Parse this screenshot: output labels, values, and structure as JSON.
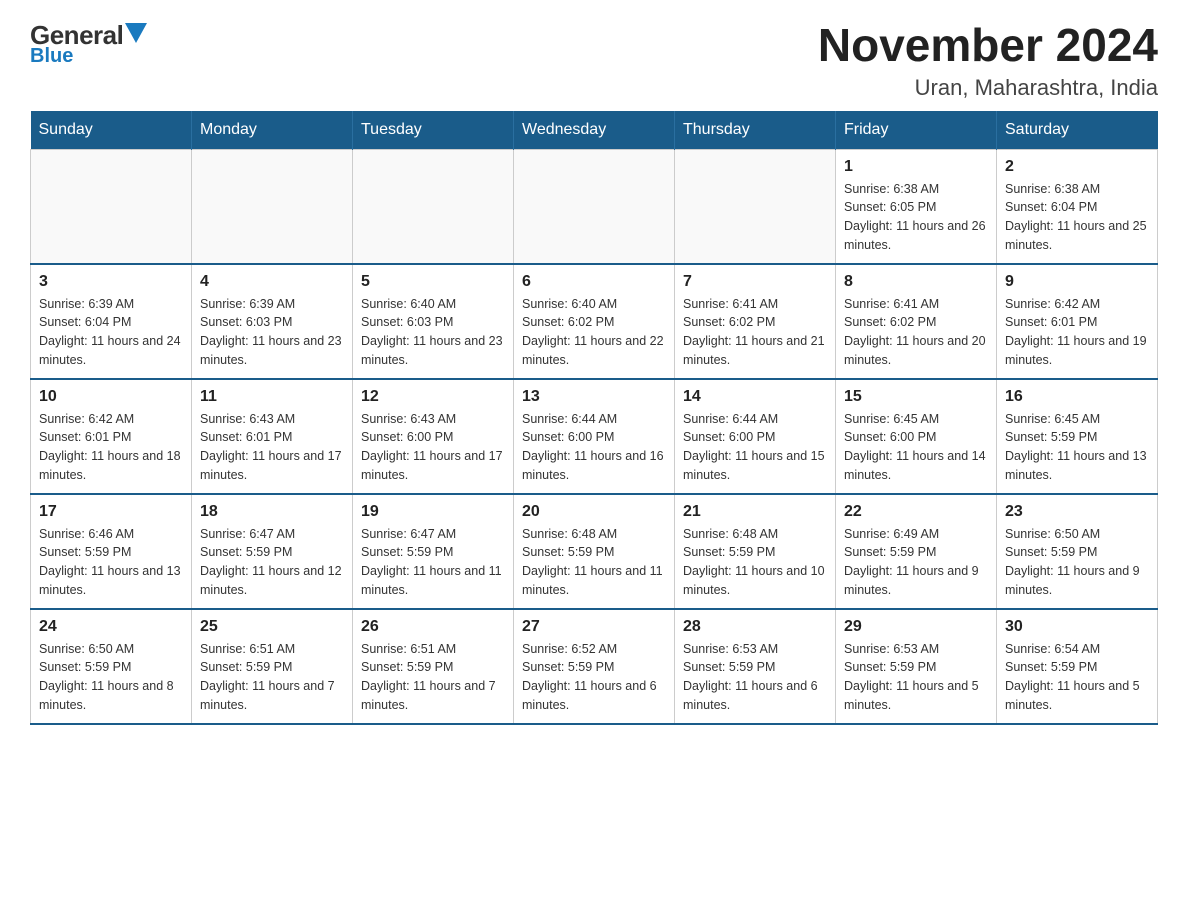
{
  "header": {
    "logo_general": "General",
    "logo_blue": "Blue",
    "month_title": "November 2024",
    "location": "Uran, Maharashtra, India"
  },
  "weekdays": [
    "Sunday",
    "Monday",
    "Tuesday",
    "Wednesday",
    "Thursday",
    "Friday",
    "Saturday"
  ],
  "weeks": [
    [
      {
        "day": "",
        "sunrise": "",
        "sunset": "",
        "daylight": ""
      },
      {
        "day": "",
        "sunrise": "",
        "sunset": "",
        "daylight": ""
      },
      {
        "day": "",
        "sunrise": "",
        "sunset": "",
        "daylight": ""
      },
      {
        "day": "",
        "sunrise": "",
        "sunset": "",
        "daylight": ""
      },
      {
        "day": "",
        "sunrise": "",
        "sunset": "",
        "daylight": ""
      },
      {
        "day": "1",
        "sunrise": "Sunrise: 6:38 AM",
        "sunset": "Sunset: 6:05 PM",
        "daylight": "Daylight: 11 hours and 26 minutes."
      },
      {
        "day": "2",
        "sunrise": "Sunrise: 6:38 AM",
        "sunset": "Sunset: 6:04 PM",
        "daylight": "Daylight: 11 hours and 25 minutes."
      }
    ],
    [
      {
        "day": "3",
        "sunrise": "Sunrise: 6:39 AM",
        "sunset": "Sunset: 6:04 PM",
        "daylight": "Daylight: 11 hours and 24 minutes."
      },
      {
        "day": "4",
        "sunrise": "Sunrise: 6:39 AM",
        "sunset": "Sunset: 6:03 PM",
        "daylight": "Daylight: 11 hours and 23 minutes."
      },
      {
        "day": "5",
        "sunrise": "Sunrise: 6:40 AM",
        "sunset": "Sunset: 6:03 PM",
        "daylight": "Daylight: 11 hours and 23 minutes."
      },
      {
        "day": "6",
        "sunrise": "Sunrise: 6:40 AM",
        "sunset": "Sunset: 6:02 PM",
        "daylight": "Daylight: 11 hours and 22 minutes."
      },
      {
        "day": "7",
        "sunrise": "Sunrise: 6:41 AM",
        "sunset": "Sunset: 6:02 PM",
        "daylight": "Daylight: 11 hours and 21 minutes."
      },
      {
        "day": "8",
        "sunrise": "Sunrise: 6:41 AM",
        "sunset": "Sunset: 6:02 PM",
        "daylight": "Daylight: 11 hours and 20 minutes."
      },
      {
        "day": "9",
        "sunrise": "Sunrise: 6:42 AM",
        "sunset": "Sunset: 6:01 PM",
        "daylight": "Daylight: 11 hours and 19 minutes."
      }
    ],
    [
      {
        "day": "10",
        "sunrise": "Sunrise: 6:42 AM",
        "sunset": "Sunset: 6:01 PM",
        "daylight": "Daylight: 11 hours and 18 minutes."
      },
      {
        "day": "11",
        "sunrise": "Sunrise: 6:43 AM",
        "sunset": "Sunset: 6:01 PM",
        "daylight": "Daylight: 11 hours and 17 minutes."
      },
      {
        "day": "12",
        "sunrise": "Sunrise: 6:43 AM",
        "sunset": "Sunset: 6:00 PM",
        "daylight": "Daylight: 11 hours and 17 minutes."
      },
      {
        "day": "13",
        "sunrise": "Sunrise: 6:44 AM",
        "sunset": "Sunset: 6:00 PM",
        "daylight": "Daylight: 11 hours and 16 minutes."
      },
      {
        "day": "14",
        "sunrise": "Sunrise: 6:44 AM",
        "sunset": "Sunset: 6:00 PM",
        "daylight": "Daylight: 11 hours and 15 minutes."
      },
      {
        "day": "15",
        "sunrise": "Sunrise: 6:45 AM",
        "sunset": "Sunset: 6:00 PM",
        "daylight": "Daylight: 11 hours and 14 minutes."
      },
      {
        "day": "16",
        "sunrise": "Sunrise: 6:45 AM",
        "sunset": "Sunset: 5:59 PM",
        "daylight": "Daylight: 11 hours and 13 minutes."
      }
    ],
    [
      {
        "day": "17",
        "sunrise": "Sunrise: 6:46 AM",
        "sunset": "Sunset: 5:59 PM",
        "daylight": "Daylight: 11 hours and 13 minutes."
      },
      {
        "day": "18",
        "sunrise": "Sunrise: 6:47 AM",
        "sunset": "Sunset: 5:59 PM",
        "daylight": "Daylight: 11 hours and 12 minutes."
      },
      {
        "day": "19",
        "sunrise": "Sunrise: 6:47 AM",
        "sunset": "Sunset: 5:59 PM",
        "daylight": "Daylight: 11 hours and 11 minutes."
      },
      {
        "day": "20",
        "sunrise": "Sunrise: 6:48 AM",
        "sunset": "Sunset: 5:59 PM",
        "daylight": "Daylight: 11 hours and 11 minutes."
      },
      {
        "day": "21",
        "sunrise": "Sunrise: 6:48 AM",
        "sunset": "Sunset: 5:59 PM",
        "daylight": "Daylight: 11 hours and 10 minutes."
      },
      {
        "day": "22",
        "sunrise": "Sunrise: 6:49 AM",
        "sunset": "Sunset: 5:59 PM",
        "daylight": "Daylight: 11 hours and 9 minutes."
      },
      {
        "day": "23",
        "sunrise": "Sunrise: 6:50 AM",
        "sunset": "Sunset: 5:59 PM",
        "daylight": "Daylight: 11 hours and 9 minutes."
      }
    ],
    [
      {
        "day": "24",
        "sunrise": "Sunrise: 6:50 AM",
        "sunset": "Sunset: 5:59 PM",
        "daylight": "Daylight: 11 hours and 8 minutes."
      },
      {
        "day": "25",
        "sunrise": "Sunrise: 6:51 AM",
        "sunset": "Sunset: 5:59 PM",
        "daylight": "Daylight: 11 hours and 7 minutes."
      },
      {
        "day": "26",
        "sunrise": "Sunrise: 6:51 AM",
        "sunset": "Sunset: 5:59 PM",
        "daylight": "Daylight: 11 hours and 7 minutes."
      },
      {
        "day": "27",
        "sunrise": "Sunrise: 6:52 AM",
        "sunset": "Sunset: 5:59 PM",
        "daylight": "Daylight: 11 hours and 6 minutes."
      },
      {
        "day": "28",
        "sunrise": "Sunrise: 6:53 AM",
        "sunset": "Sunset: 5:59 PM",
        "daylight": "Daylight: 11 hours and 6 minutes."
      },
      {
        "day": "29",
        "sunrise": "Sunrise: 6:53 AM",
        "sunset": "Sunset: 5:59 PM",
        "daylight": "Daylight: 11 hours and 5 minutes."
      },
      {
        "day": "30",
        "sunrise": "Sunrise: 6:54 AM",
        "sunset": "Sunset: 5:59 PM",
        "daylight": "Daylight: 11 hours and 5 minutes."
      }
    ]
  ]
}
